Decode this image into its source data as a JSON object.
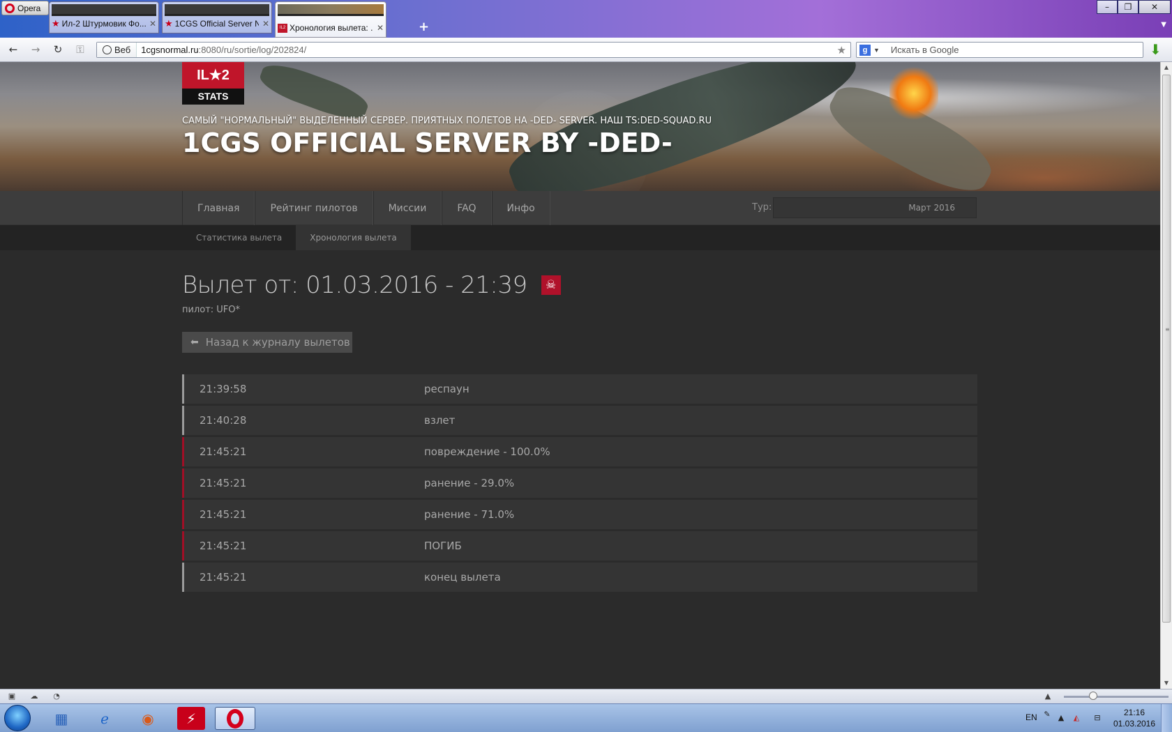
{
  "browser": {
    "menu_label": "Opera",
    "tabs": [
      {
        "title": "Ил-2 Штурмовик Фо..."
      },
      {
        "title": "1CGS Official Server N..."
      },
      {
        "title": "Хронология вылета: ..."
      }
    ],
    "address": {
      "badge_label": "Веб",
      "url_host": "1cgsnormal.ru",
      "url_rest": ":8080/ru/sortie/log/202824/"
    },
    "search": {
      "placeholder": "Искать в Google"
    },
    "window_controls": {
      "minimize": "–",
      "restore": "❐",
      "close": "✕"
    }
  },
  "site": {
    "logo_top": "IL★2",
    "logo_bottom": "STATS",
    "tagline": "САМЫЙ \"НОРМАЛЬНЫЙ\" ВЫДЕЛЕННЫЙ СЕРВЕР. ПРИЯТНЫХ ПОЛЕТОВ НА -DED- SERVER. НАШ TS:DED-SQUAD.RU",
    "server_title": "1CGS OFFICIAL SERVER BY -DED-",
    "nav": [
      "Главная",
      "Рейтинг пилотов",
      "Миссии",
      "FAQ",
      "Инфо"
    ],
    "tour_label": "Тур:",
    "tour_value": "Март 2016",
    "subnav": [
      {
        "label": "Статистика вылета",
        "active": false
      },
      {
        "label": "Хронология вылета",
        "active": true
      }
    ]
  },
  "sortie": {
    "title": "Вылет от: 01.03.2016 - 21:39",
    "status_icon": "skull-icon",
    "pilot_line": "пилот: UFO*",
    "back_label": "Назад к журналу вылетов",
    "events": [
      {
        "time": "21:39:58",
        "desc": "респаун",
        "severity": "normal"
      },
      {
        "time": "21:40:28",
        "desc": "взлет",
        "severity": "normal"
      },
      {
        "time": "21:45:21",
        "desc": "повреждение - 100.0%",
        "severity": "bad"
      },
      {
        "time": "21:45:21",
        "desc": "ранение - 29.0%",
        "severity": "bad"
      },
      {
        "time": "21:45:21",
        "desc": "ранение - 71.0%",
        "severity": "bad"
      },
      {
        "time": "21:45:21",
        "desc": "ПОГИБ",
        "severity": "bad"
      },
      {
        "time": "21:45:21",
        "desc": "конец вылета",
        "severity": "normal"
      }
    ]
  },
  "taskbar": {
    "lang": "EN",
    "time": "21:16",
    "date": "01.03.2016"
  },
  "colors": {
    "accent_red": "#b0112a",
    "page_bg": "#2b2b2b",
    "row_bg": "#343434"
  }
}
